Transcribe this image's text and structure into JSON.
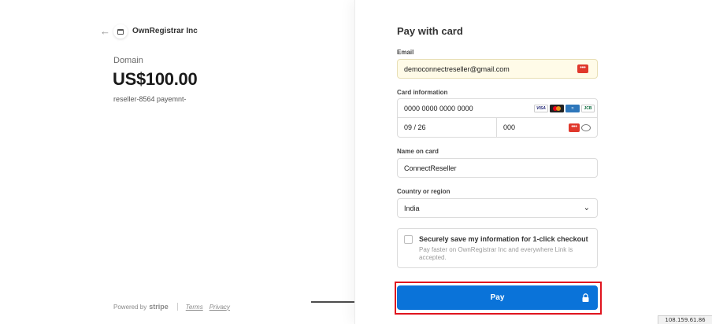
{
  "merchant": {
    "name": "OwnRegistrar Inc"
  },
  "product": {
    "label": "Domain",
    "price": "US$100.00",
    "description": "reseller-8564 payemnt-"
  },
  "footer": {
    "powered_by": "Powered by",
    "brand": "stripe",
    "terms": "Terms",
    "privacy": "Privacy"
  },
  "form": {
    "title": "Pay with card",
    "email": {
      "label": "Email",
      "value": "democonnectreseller@gmail.com"
    },
    "card": {
      "label": "Card information",
      "number": "0000 0000 0000 0000",
      "expiry": "09 / 26",
      "cvc": "000",
      "brands": [
        "VISA",
        "Mastercard",
        "AMEX",
        "JCB"
      ]
    },
    "name": {
      "label": "Name on card",
      "value": "ConnectReseller"
    },
    "country": {
      "label": "Country or region",
      "value": "India"
    },
    "save": {
      "title": "Securely save my information for 1-click checkout",
      "subtitle": "Pay faster on OwnRegistrar Inc and everywhere Link is accepted."
    },
    "pay_button": "Pay"
  },
  "ip_badge": "108.159.61.86",
  "colors": {
    "accent": "#0a73d9",
    "highlight": "#e0141e",
    "link": "#e0382c"
  },
  "icons": [
    "back-arrow-icon",
    "store-icon",
    "link-icon",
    "visa-icon",
    "mastercard-icon",
    "amex-icon",
    "jcb-icon",
    "cvc-icon",
    "chevron-down-icon",
    "lock-icon",
    "pointer-arrow-icon"
  ]
}
